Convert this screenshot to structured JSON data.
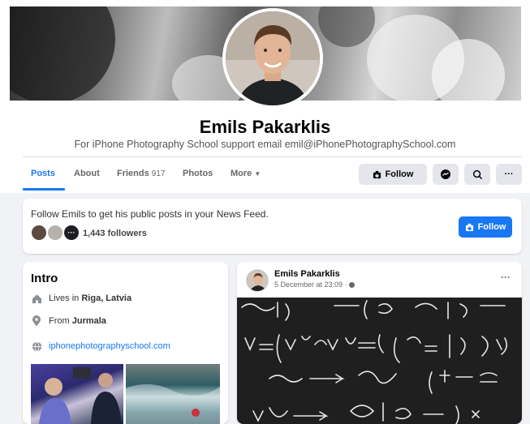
{
  "profile": {
    "name": "Emils Pakarklis",
    "bio": "For iPhone Photography School support email emil@iPhonePhotographySchool.com"
  },
  "tabs": [
    {
      "label": "Posts",
      "active": true
    },
    {
      "label": "About"
    },
    {
      "label": "Friends",
      "count": "917"
    },
    {
      "label": "Photos"
    },
    {
      "label": "More"
    }
  ],
  "actions": {
    "follow_label": "Follow",
    "messenger_icon": "messenger-icon",
    "search_icon": "search-icon",
    "more_label": "···"
  },
  "follow_card": {
    "text": "Follow Emils to get his public posts in your News Feed.",
    "followers": "1,443 followers",
    "more_avatar_label": "···",
    "button_label": "Follow"
  },
  "intro": {
    "title": "Intro",
    "lives_prefix": "Lives in",
    "lives_value": "Riga, Latvia",
    "from_prefix": "From",
    "from_value": "Jurmala",
    "website": "iphonephotographyschool.com"
  },
  "post": {
    "author": "Emils Pakarklis",
    "date": "5 December at 23:09 · ",
    "more_label": "···"
  },
  "colors": {
    "accent": "#1877f2",
    "background": "#f0f2f5",
    "button_gray": "#e4e6eb"
  }
}
